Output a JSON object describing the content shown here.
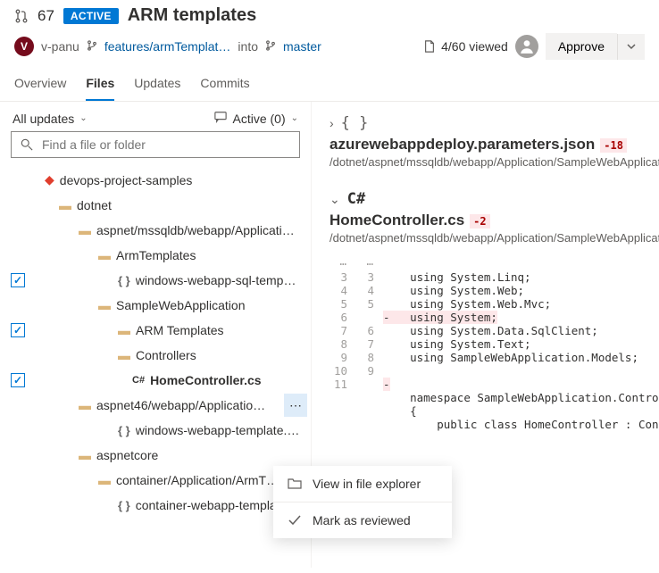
{
  "header": {
    "pr_number": "67",
    "status_badge": "ACTIVE",
    "title": "ARM templates"
  },
  "sub": {
    "avatar_initial": "V",
    "author": "v-panu",
    "source_branch": "features/armTemplat…",
    "into_word": "into",
    "target_branch": "master",
    "viewed": "4/60 viewed",
    "approve_label": "Approve"
  },
  "tabs": [
    "Overview",
    "Files",
    "Updates",
    "Commits"
  ],
  "left_panel": {
    "updates_dd": "All updates",
    "active_dd": "Active (0)",
    "search_placeholder": "Find a file or folder"
  },
  "tree": {
    "root": "devops-project-samples",
    "dotnet": "dotnet",
    "aspnet": "aspnet/mssqldb/webapp/Applicati…",
    "armtemplates": "ArmTemplates",
    "winsql": "windows-webapp-sql-temp…",
    "samplewebapp": "SampleWebApplication",
    "armtemplates2": "ARM Templates",
    "controllers": "Controllers",
    "homecontroller": "HomeController.cs",
    "aspnet46": "aspnet46/webapp/Applicatio…",
    "wintemplate": "windows-webapp-template.…",
    "aspnetcore": "aspnetcore",
    "container": "container/Application/ArmT…",
    "containertemplat": "container-webapp-templat…"
  },
  "menu": {
    "view_explorer": "View in file explorer",
    "mark_reviewed": "Mark as reviewed"
  },
  "file1": {
    "name": "azurewebappdeploy.parameters.json",
    "delta": "-18",
    "path": "/dotnet/aspnet/mssqldb/webapp/Application/SampleWebApplicat"
  },
  "file2": {
    "lang": "C#",
    "name": "HomeController.cs",
    "delta": "-2",
    "path": "/dotnet/aspnet/mssqldb/webapp/Application/SampleWebApplicat"
  },
  "diff": {
    "l3": "using System.Linq;",
    "l4": "using System.Web;",
    "l5": "using System.Web.Mvc;",
    "l6": "using System;",
    "l7": "using System.Data.SqlClient;",
    "l8": "using System.Text;",
    "l9": "using SampleWebApplication.Models;",
    "lns": "namespace SampleWebApplication.Contro",
    "brace": "{",
    "cls": "    public class HomeController : Con"
  }
}
